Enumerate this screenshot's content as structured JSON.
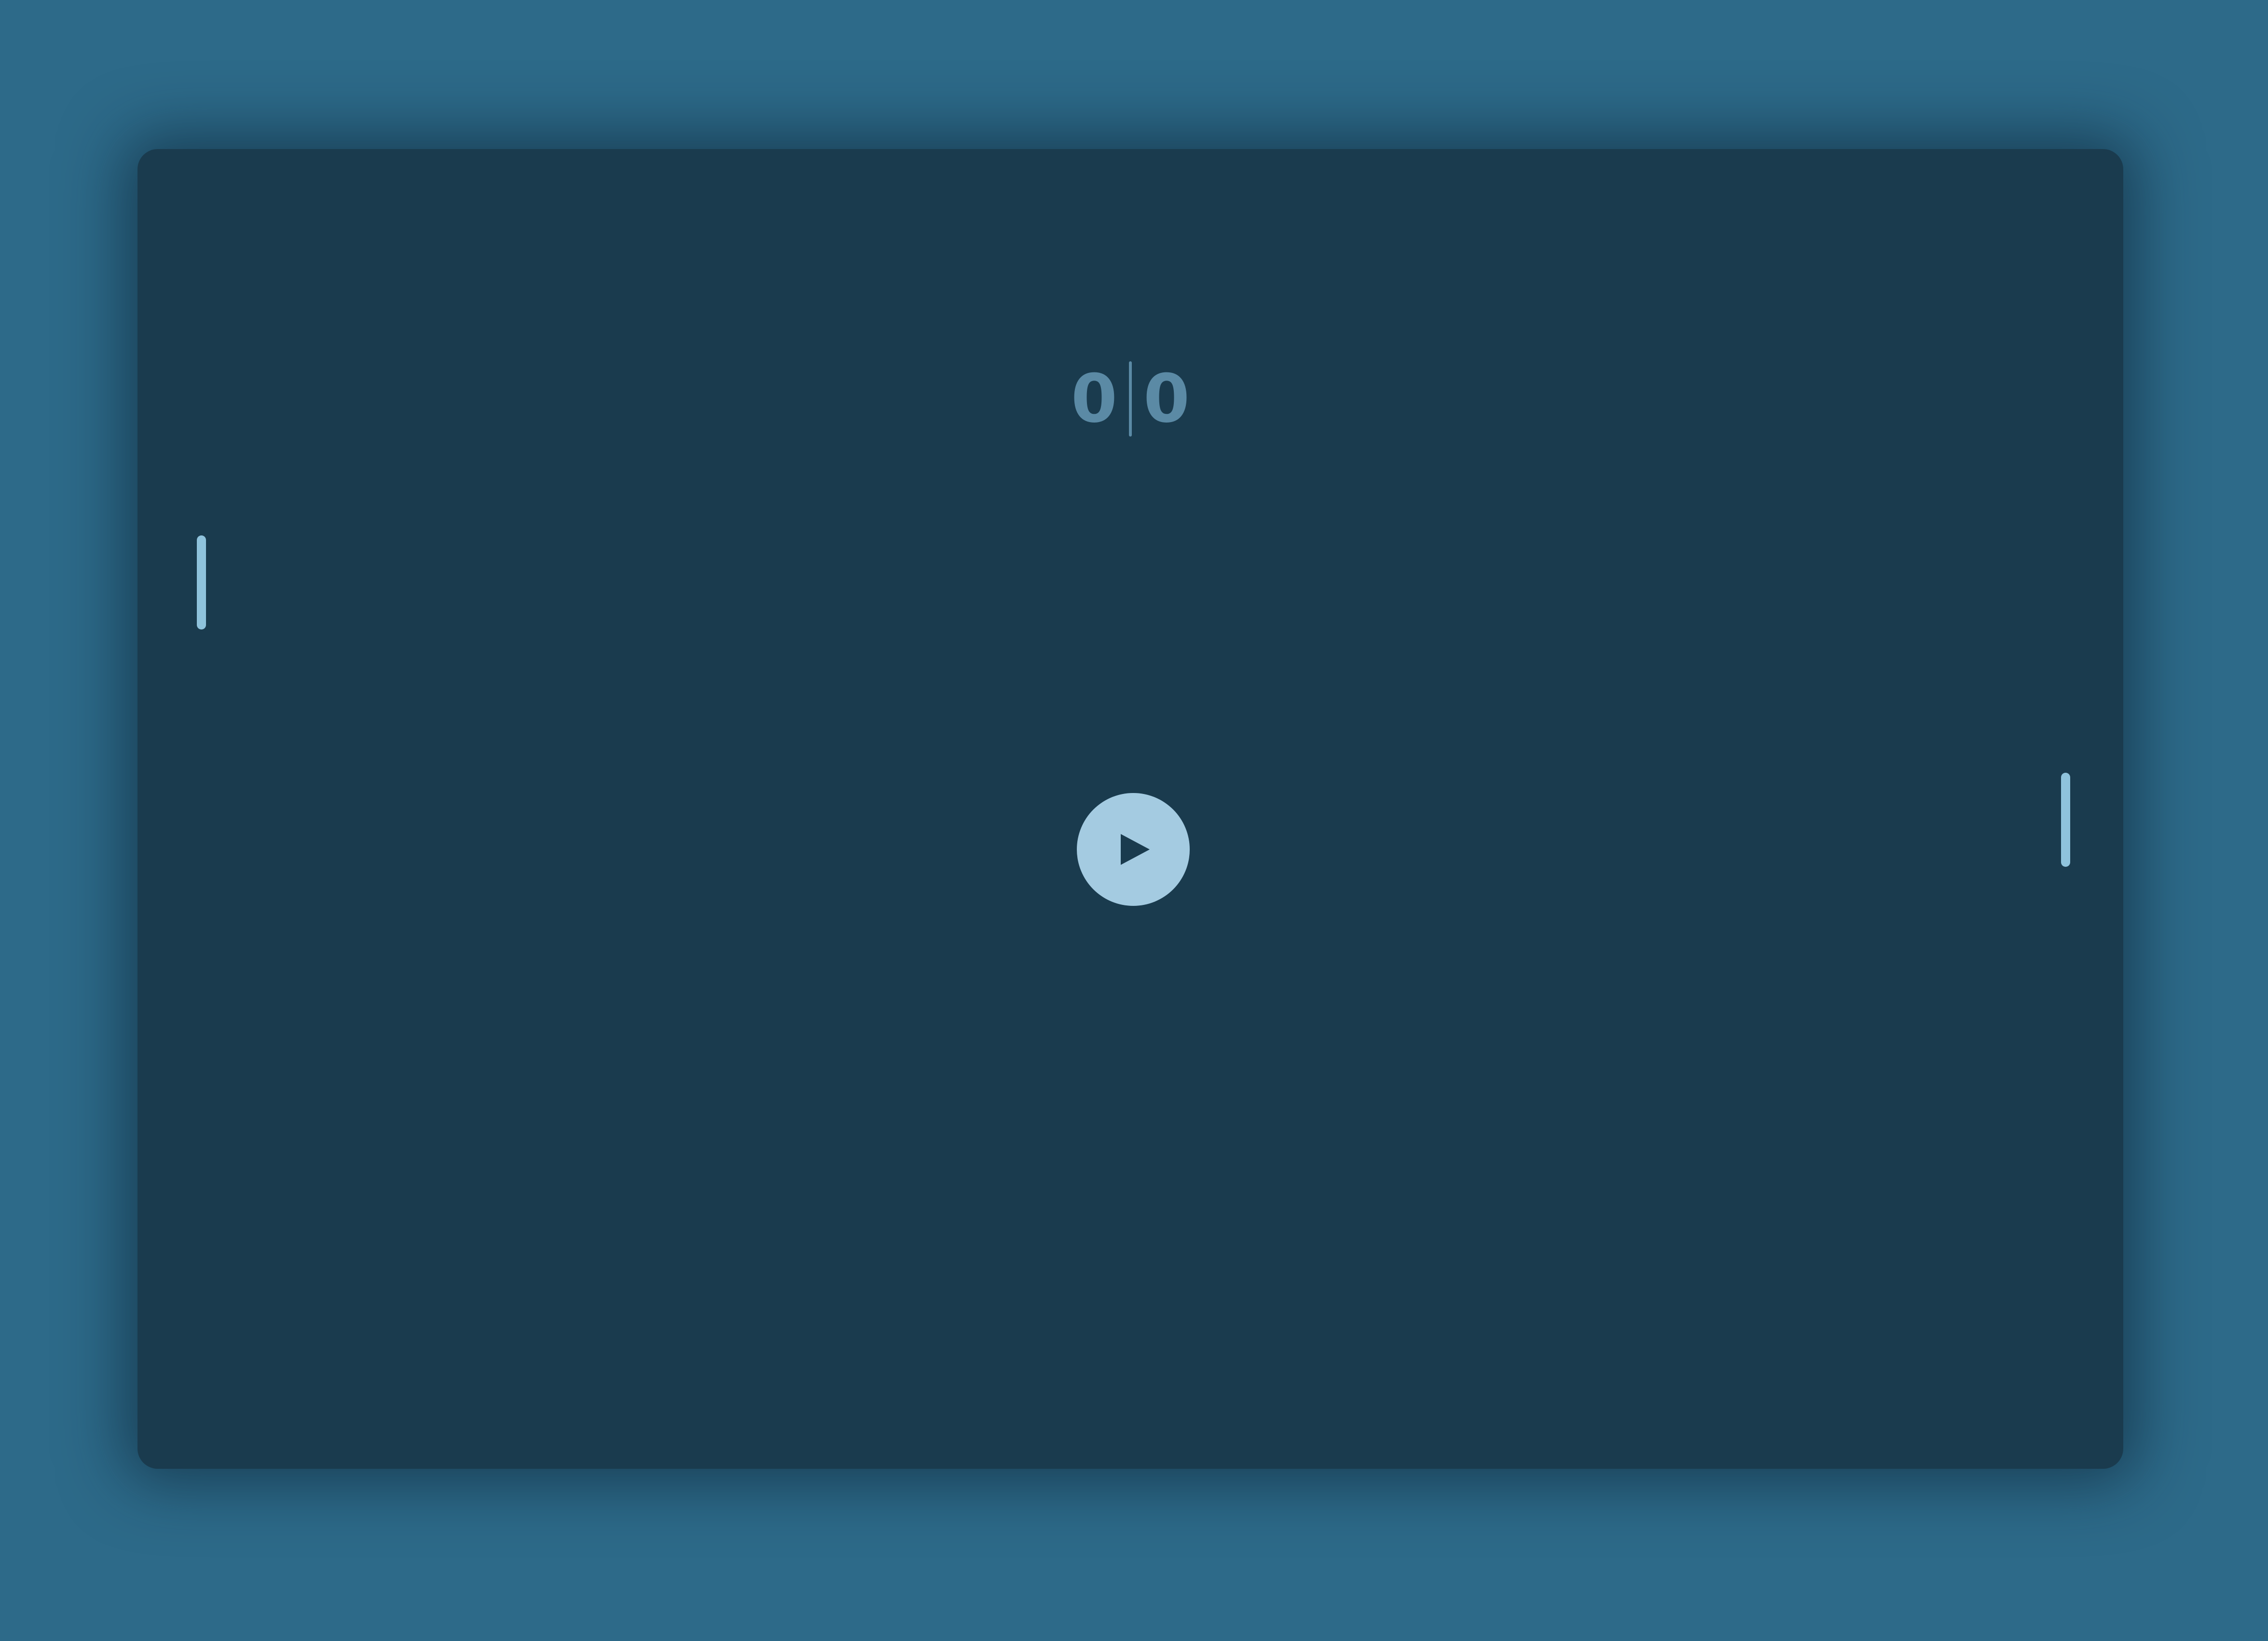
{
  "score": {
    "left": "0",
    "right": "0"
  },
  "controls": {
    "play_icon": "play-icon"
  },
  "colors": {
    "background": "#2d6a89",
    "board": "#1a3b4e",
    "paddle": "#8fc3dc",
    "score_text": "#5b8aa5",
    "play_button": "#a4cbe1",
    "play_icon": "#1a3b4e"
  }
}
